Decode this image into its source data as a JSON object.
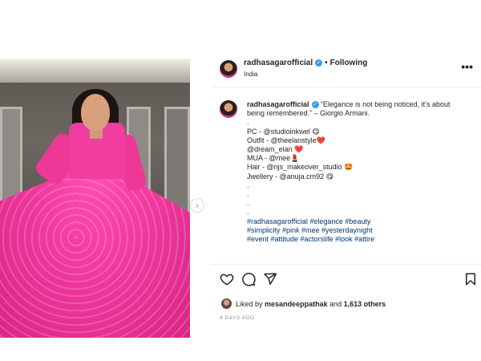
{
  "post": {
    "username": "radhasagarofficial",
    "follow_label": "Following",
    "location": "India",
    "more_label": "•••",
    "next_label": "›"
  },
  "caption": {
    "username": "radhasagarofficial",
    "lines": [
      "“Elegance is not being noticed, it’s about",
      "being remembered.” – Giorgio Armani.",
      ".",
      "PC - @studioinkwel 😋",
      "Outfit - @theelanstyle❤️",
      "@dream_elan ❤️",
      "MUA - @mee💄",
      "Hair - @njs_makeover_studio 🤩",
      "Jwellery - @anuja.cm92 😋",
      ".",
      ".",
      ".",
      ".",
      "#radhasagarofficial #elegance #beauty",
      "#simplicity #pink #mee #yesterdaynight",
      "#event #attitude #actorslife #look #attire"
    ]
  },
  "likes": {
    "prefix": "Liked by ",
    "user": "mesandeeppathak",
    "middle": " and ",
    "count": "1,613 others"
  },
  "timestamp": "4 DAYS AGO",
  "colors": {
    "link": "#00376b",
    "verified": "#3897f0",
    "gown": "#f0389e"
  }
}
